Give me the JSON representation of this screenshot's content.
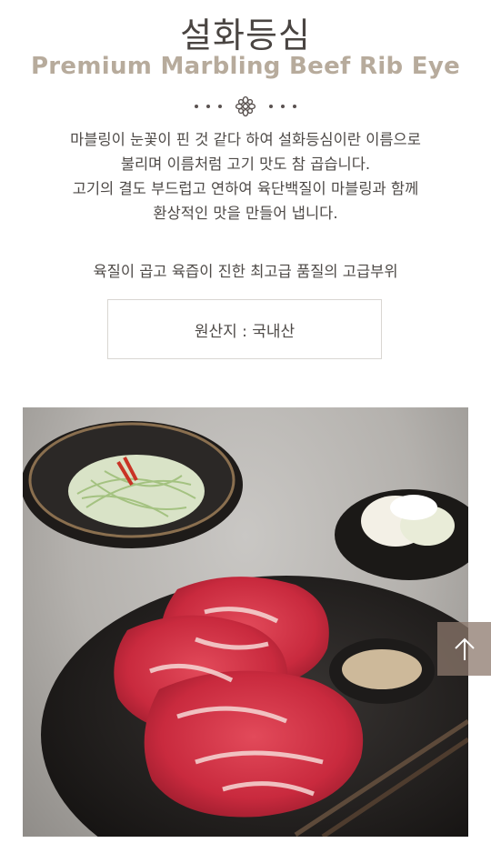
{
  "header": {
    "title_ko": "설화등심",
    "title_en": "Premium Marbling Beef Rib Eye"
  },
  "description": {
    "lines": [
      "마블링이 눈꽃이 핀 것 같다 하여 설화등심이란 이름으로",
      "불리며 이름처럼 고기 맛도 참 곱습니다.",
      "고기의 결도 부드럽고 연하여 육단백질이 마블링과 함께",
      "환상적인 맛을 만들어 냅니다."
    ],
    "highlight": "육질이 곱고 육즙이 진한 최고급 품질의 고급부위"
  },
  "origin": {
    "label": "원산지 : 국내산"
  },
  "photo": {
    "subject": "marbled rib eye steaks on dark plate with green onion salad, pickled radish and seasoning"
  },
  "scroll_top": {
    "icon": "arrow-up-icon"
  },
  "colors": {
    "title": "#4a4542",
    "subtitle": "#b7ab9c",
    "body_text": "#4e4a47",
    "box_border": "#d9d6d2",
    "top_button": "#8c786c"
  }
}
